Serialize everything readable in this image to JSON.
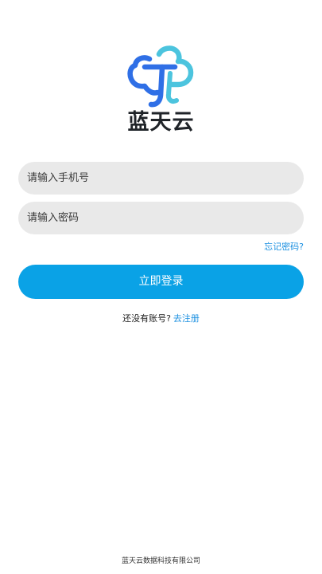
{
  "brand": {
    "name": "蓝天云",
    "logo_icon": "cloud-t-logo-icon",
    "colors": {
      "logo_blue": "#2f6fe6",
      "logo_cyan": "#4cc4de"
    }
  },
  "form": {
    "phone_placeholder": "请输入手机号",
    "phone_value": "",
    "password_placeholder": "请输入密码",
    "password_value": "",
    "forgot_password": "忘记密码?",
    "login_label": "立即登录"
  },
  "register": {
    "prompt": "还没有账号?",
    "link_label": "去注册"
  },
  "footer": {
    "company": "蓝天云数据科技有限公司"
  },
  "colors": {
    "primary": "#0aa2e6",
    "link": "#1a8fe0",
    "input_background": "#e9e9e9"
  }
}
